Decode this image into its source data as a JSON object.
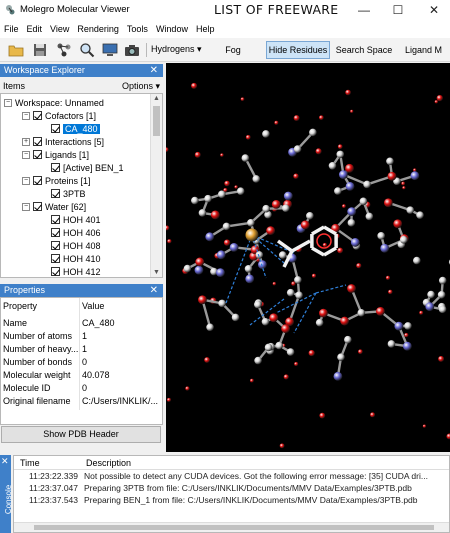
{
  "window": {
    "title": "Molegro Molecular Viewer",
    "watermark": "LIST OF FREEWARE",
    "controls": {
      "minimize": "—",
      "maximize": "☐",
      "close": "✕"
    }
  },
  "menu": [
    "File",
    "Edit",
    "View",
    "Rendering",
    "Tools",
    "Window",
    "Help"
  ],
  "toolbar": {
    "icons": [
      "folder-open-icon",
      "save-icon",
      "molecule-icon",
      "magnifier-icon",
      "monitor-icon",
      "camera-icon"
    ],
    "hydrogens": "Hydrogens ▾",
    "fog": "Fog",
    "hide_residues": "Hide Residues",
    "search_space": "Search Space",
    "ligand_map": "Ligand M"
  },
  "workspace_explorer": {
    "title": "Workspace Explorer",
    "items_label": "Items",
    "options_label": "Options ▾",
    "tree": [
      {
        "label": "Workspace: Unnamed",
        "level": 0,
        "expander": "−",
        "checkbox": false
      },
      {
        "label": "Cofactors [1]",
        "level": 1,
        "expander": "−",
        "checkbox": true
      },
      {
        "label": "CA_480",
        "level": 2,
        "expander": "",
        "checkbox": true,
        "selected": true
      },
      {
        "label": "Interactions [5]",
        "level": 1,
        "expander": "+",
        "checkbox": true
      },
      {
        "label": "Ligands [1]",
        "level": 1,
        "expander": "−",
        "checkbox": true
      },
      {
        "label": "[Active] BEN_1",
        "level": 2,
        "expander": "",
        "checkbox": true
      },
      {
        "label": "Proteins [1]",
        "level": 1,
        "expander": "−",
        "checkbox": true
      },
      {
        "label": "3PTB",
        "level": 2,
        "expander": "",
        "checkbox": true
      },
      {
        "label": "Water [62]",
        "level": 1,
        "expander": "−",
        "checkbox": true
      },
      {
        "label": "HOH 401",
        "level": 2,
        "expander": "",
        "checkbox": true
      },
      {
        "label": "HOH 406",
        "level": 2,
        "expander": "",
        "checkbox": true
      },
      {
        "label": "HOH 408",
        "level": 2,
        "expander": "",
        "checkbox": true
      },
      {
        "label": "HOH 410",
        "level": 2,
        "expander": "",
        "checkbox": true
      },
      {
        "label": "HOH 412",
        "level": 2,
        "expander": "",
        "checkbox": true
      }
    ]
  },
  "properties": {
    "title": "Properties",
    "col_property": "Property",
    "col_value": "Value",
    "rows": [
      {
        "k": "Name",
        "v": "CA_480"
      },
      {
        "k": "Number of atoms",
        "v": "1"
      },
      {
        "k": "Number of heavy...",
        "v": "1"
      },
      {
        "k": "Number of bonds",
        "v": "0"
      },
      {
        "k": "Molecular weight",
        "v": "40.078"
      },
      {
        "k": "Molecule ID",
        "v": "0"
      },
      {
        "k": "Original filename",
        "v": "C:/Users/INKLIK/..."
      }
    ],
    "button": "Show PDB Header"
  },
  "console": {
    "label": "Console",
    "col_time": "Time",
    "col_desc": "Description",
    "rows": [
      {
        "t": "11:23:22.339",
        "d": "Not possible to detect any CUDA devices. Got the following error message: [35] CUDA dri..."
      },
      {
        "t": "11:23:37.047",
        "d": "Preparing 3PTB from file: C:/Users/INKLIK/Documents/MMV Data/Examples/3PTB.pdb"
      },
      {
        "t": "11:23:37.543",
        "d": "Preparing BEN_1 from file: C:/Users/INKLIK/Documents/MMV Data/Examples/3PTB.pdb"
      }
    ]
  },
  "viewport_colors": {
    "background": "#000000",
    "carbon": "#d8d8d8",
    "oxygen": "#e01010",
    "nitrogen": "#6b6bd6",
    "calcium": "#e0a030",
    "hbond": "#2f7fd8",
    "ligand": "#f2f2f2",
    "ligand_accent": "#ff3030"
  }
}
